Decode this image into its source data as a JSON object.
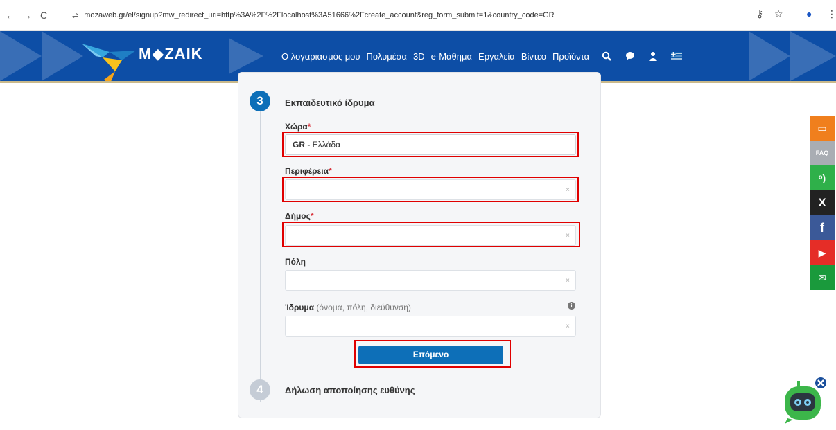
{
  "browser": {
    "url": "mozaweb.gr/el/signup?mw_redirect_uri=http%3A%2F%2Flocalhost%3A51666%2Fcreate_account&reg_form_submit=1&country_code=GR",
    "back_icon": "←",
    "forward_icon": "→",
    "reload_icon": "C",
    "site_info_icon": "⇌",
    "key_icon": "⚷",
    "star_icon": "☆",
    "profile_icon": "●",
    "menu_icon": "⋮"
  },
  "header": {
    "logo_text": "M◆ZAIK",
    "nav": [
      "Ο λογαριασμός μου",
      "Πολυμέσα",
      "3D",
      "e-Μάθημα",
      "Εργαλεία",
      "Βίντεο",
      "Προϊόντα"
    ],
    "icons": [
      "search-icon",
      "chat-icon",
      "user-icon",
      "greek-flag-icon"
    ],
    "bg_color": "#0d4ea6"
  },
  "form": {
    "step3_number": "3",
    "step3_title": "Εκπαιδευτικό ίδρυμα",
    "country_label": "Χώρα",
    "country_code": "GR",
    "country_name": " - Ελλάδα",
    "region_label": "Περιφέρεια",
    "region_value": "",
    "municipality_label": "Δήμος",
    "municipality_value": "",
    "city_label": "Πόλη",
    "city_value": "",
    "institution_label": "Ίδρυμα",
    "institution_hint": " (όνομα, πόλη, διεύθυνση)",
    "institution_value": "",
    "required_mark": "*",
    "clear_mark": "×",
    "info_mark": "i",
    "next_label": "Επόμενο",
    "step4_number": "4",
    "step4_title": "Δήλωση αποποίησης ευθύνης"
  },
  "social": [
    {
      "name": "comment-icon",
      "color": "#f07f1d",
      "glyph": "▭"
    },
    {
      "name": "faq-icon",
      "color": "#a9adb3",
      "glyph": "FAQ"
    },
    {
      "name": "rss-icon",
      "color": "#2fb04a",
      "glyph": "ᵒ)"
    },
    {
      "name": "x-icon",
      "color": "#222222",
      "glyph": "X"
    },
    {
      "name": "facebook-icon",
      "color": "#3b5998",
      "glyph": "f"
    },
    {
      "name": "youtube-icon",
      "color": "#e52d27",
      "glyph": "▶"
    },
    {
      "name": "email-icon",
      "color": "#1a9a3c",
      "glyph": "✉"
    }
  ]
}
